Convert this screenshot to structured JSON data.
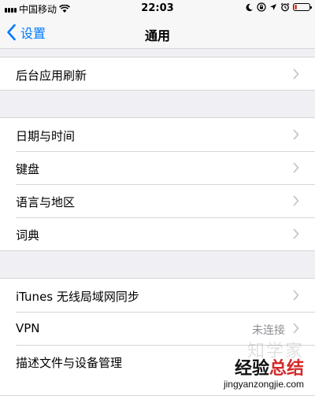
{
  "status_bar": {
    "carrier": "中国移动",
    "time": "22:03",
    "battery_level": 0.15,
    "icons": [
      "signal-icon",
      "wifi-icon",
      "moon-icon",
      "lock-rotation-icon",
      "location-icon",
      "alarm-icon",
      "battery-icon"
    ]
  },
  "nav": {
    "back_label": "设置",
    "title": "通用"
  },
  "sections": [
    {
      "rows": [
        {
          "label": "后台应用刷新"
        }
      ]
    },
    {
      "rows": [
        {
          "label": "日期与时间"
        },
        {
          "label": "键盘"
        },
        {
          "label": "语言与地区"
        },
        {
          "label": "词典"
        }
      ]
    },
    {
      "rows": [
        {
          "label": "iTunes 无线局域网同步"
        },
        {
          "label": "VPN",
          "value": "未连接"
        },
        {
          "label": "描述文件与设备管理"
        }
      ]
    }
  ],
  "watermark": {
    "faint_text": "知学家",
    "main_prefix": "经验",
    "main_accent": "总结",
    "url": "jingyanzongjie.com"
  },
  "colors": {
    "accent": "#007aff",
    "background": "#efeff4",
    "battery_low": "#e0453a"
  }
}
